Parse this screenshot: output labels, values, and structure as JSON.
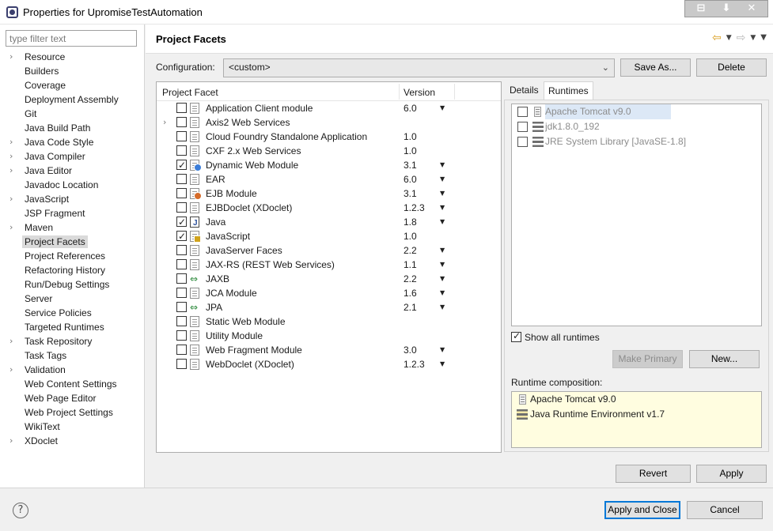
{
  "window": {
    "title": "Properties for UpromiseTestAutomation",
    "controls": [
      "⊟",
      "⬇",
      "✕"
    ]
  },
  "sidebar": {
    "filter_placeholder": "type filter text",
    "items": [
      {
        "label": "Resource",
        "expandable": true
      },
      {
        "label": "Builders",
        "expandable": false
      },
      {
        "label": "Coverage",
        "expandable": false
      },
      {
        "label": "Deployment Assembly",
        "expandable": false
      },
      {
        "label": "Git",
        "expandable": false
      },
      {
        "label": "Java Build Path",
        "expandable": false
      },
      {
        "label": "Java Code Style",
        "expandable": true
      },
      {
        "label": "Java Compiler",
        "expandable": true
      },
      {
        "label": "Java Editor",
        "expandable": true
      },
      {
        "label": "Javadoc Location",
        "expandable": false
      },
      {
        "label": "JavaScript",
        "expandable": true
      },
      {
        "label": "JSP Fragment",
        "expandable": false
      },
      {
        "label": "Maven",
        "expandable": true
      },
      {
        "label": "Project Facets",
        "expandable": false,
        "selected": true
      },
      {
        "label": "Project References",
        "expandable": false
      },
      {
        "label": "Refactoring History",
        "expandable": false
      },
      {
        "label": "Run/Debug Settings",
        "expandable": false
      },
      {
        "label": "Server",
        "expandable": false
      },
      {
        "label": "Service Policies",
        "expandable": false
      },
      {
        "label": "Targeted Runtimes",
        "expandable": false
      },
      {
        "label": "Task Repository",
        "expandable": true
      },
      {
        "label": "Task Tags",
        "expandable": false
      },
      {
        "label": "Validation",
        "expandable": true
      },
      {
        "label": "Web Content Settings",
        "expandable": false
      },
      {
        "label": "Web Page Editor",
        "expandable": false
      },
      {
        "label": "Web Project Settings",
        "expandable": false
      },
      {
        "label": "WikiText",
        "expandable": false
      },
      {
        "label": "XDoclet",
        "expandable": true
      }
    ]
  },
  "page": {
    "title": "Project Facets",
    "configuration_label": "Configuration:",
    "configuration_value": "<custom>",
    "save_as_label": "Save As...",
    "delete_label": "Delete"
  },
  "facets": {
    "col_facet": "Project Facet",
    "col_version": "Version",
    "rows": [
      {
        "name": "Application Client module",
        "version": "6.0",
        "checked": false,
        "dropdown": true,
        "expandable": false,
        "icon": "doc"
      },
      {
        "name": "Axis2 Web Services",
        "version": "",
        "checked": false,
        "dropdown": false,
        "expandable": true,
        "icon": "doc"
      },
      {
        "name": "Cloud Foundry Standalone Application",
        "version": "1.0",
        "checked": false,
        "dropdown": false,
        "expandable": false,
        "icon": "doc"
      },
      {
        "name": "CXF 2.x Web Services",
        "version": "1.0",
        "checked": false,
        "dropdown": false,
        "expandable": false,
        "icon": "doc"
      },
      {
        "name": "Dynamic Web Module",
        "version": "3.1",
        "checked": true,
        "dropdown": true,
        "expandable": false,
        "icon": "globe"
      },
      {
        "name": "EAR",
        "version": "6.0",
        "checked": false,
        "dropdown": true,
        "expandable": false,
        "icon": "doc"
      },
      {
        "name": "EJB Module",
        "version": "3.1",
        "checked": false,
        "dropdown": true,
        "expandable": false,
        "icon": "bean"
      },
      {
        "name": "EJBDoclet (XDoclet)",
        "version": "1.2.3",
        "checked": false,
        "dropdown": true,
        "expandable": false,
        "icon": "doc"
      },
      {
        "name": "Java",
        "version": "1.8",
        "checked": true,
        "dropdown": true,
        "expandable": false,
        "icon": "java"
      },
      {
        "name": "JavaScript",
        "version": "1.0",
        "checked": true,
        "dropdown": false,
        "expandable": false,
        "icon": "js"
      },
      {
        "name": "JavaServer Faces",
        "version": "2.2",
        "checked": false,
        "dropdown": true,
        "expandable": false,
        "icon": "doc"
      },
      {
        "name": "JAX-RS (REST Web Services)",
        "version": "1.1",
        "checked": false,
        "dropdown": true,
        "expandable": false,
        "icon": "doc"
      },
      {
        "name": "JAXB",
        "version": "2.2",
        "checked": false,
        "dropdown": true,
        "expandable": false,
        "icon": "arrows"
      },
      {
        "name": "JCA Module",
        "version": "1.6",
        "checked": false,
        "dropdown": true,
        "expandable": false,
        "icon": "doc"
      },
      {
        "name": "JPA",
        "version": "2.1",
        "checked": false,
        "dropdown": true,
        "expandable": false,
        "icon": "arrows"
      },
      {
        "name": "Static Web Module",
        "version": "",
        "checked": false,
        "dropdown": false,
        "expandable": false,
        "icon": "doc"
      },
      {
        "name": "Utility Module",
        "version": "",
        "checked": false,
        "dropdown": false,
        "expandable": false,
        "icon": "doc"
      },
      {
        "name": "Web Fragment Module",
        "version": "3.0",
        "checked": false,
        "dropdown": true,
        "expandable": false,
        "icon": "doc"
      },
      {
        "name": "WebDoclet (XDoclet)",
        "version": "1.2.3",
        "checked": false,
        "dropdown": true,
        "expandable": false,
        "icon": "doc"
      }
    ]
  },
  "tabs": {
    "details": "Details",
    "runtimes": "Runtimes",
    "active": "Runtimes"
  },
  "runtimes": {
    "items": [
      {
        "name": "Apache Tomcat v9.0",
        "checked": false,
        "highlighted": true,
        "icon": "tomcat"
      },
      {
        "name": "jdk1.8.0_192",
        "checked": false,
        "highlighted": false,
        "icon": "jdk"
      },
      {
        "name": "JRE System Library [JavaSE-1.8]",
        "checked": false,
        "highlighted": false,
        "icon": "jdk"
      }
    ],
    "show_all_label": "Show all runtimes",
    "show_all_checked": true,
    "make_primary_label": "Make Primary",
    "new_label": "New...",
    "composition_label": "Runtime composition:",
    "composition": [
      {
        "name": "Apache Tomcat v9.0",
        "icon": "tomcat"
      },
      {
        "name": "Java Runtime Environment v1.7",
        "icon": "jre"
      }
    ]
  },
  "footer": {
    "revert_label": "Revert",
    "apply_label": "Apply",
    "apply_close_label": "Apply and Close",
    "cancel_label": "Cancel"
  }
}
